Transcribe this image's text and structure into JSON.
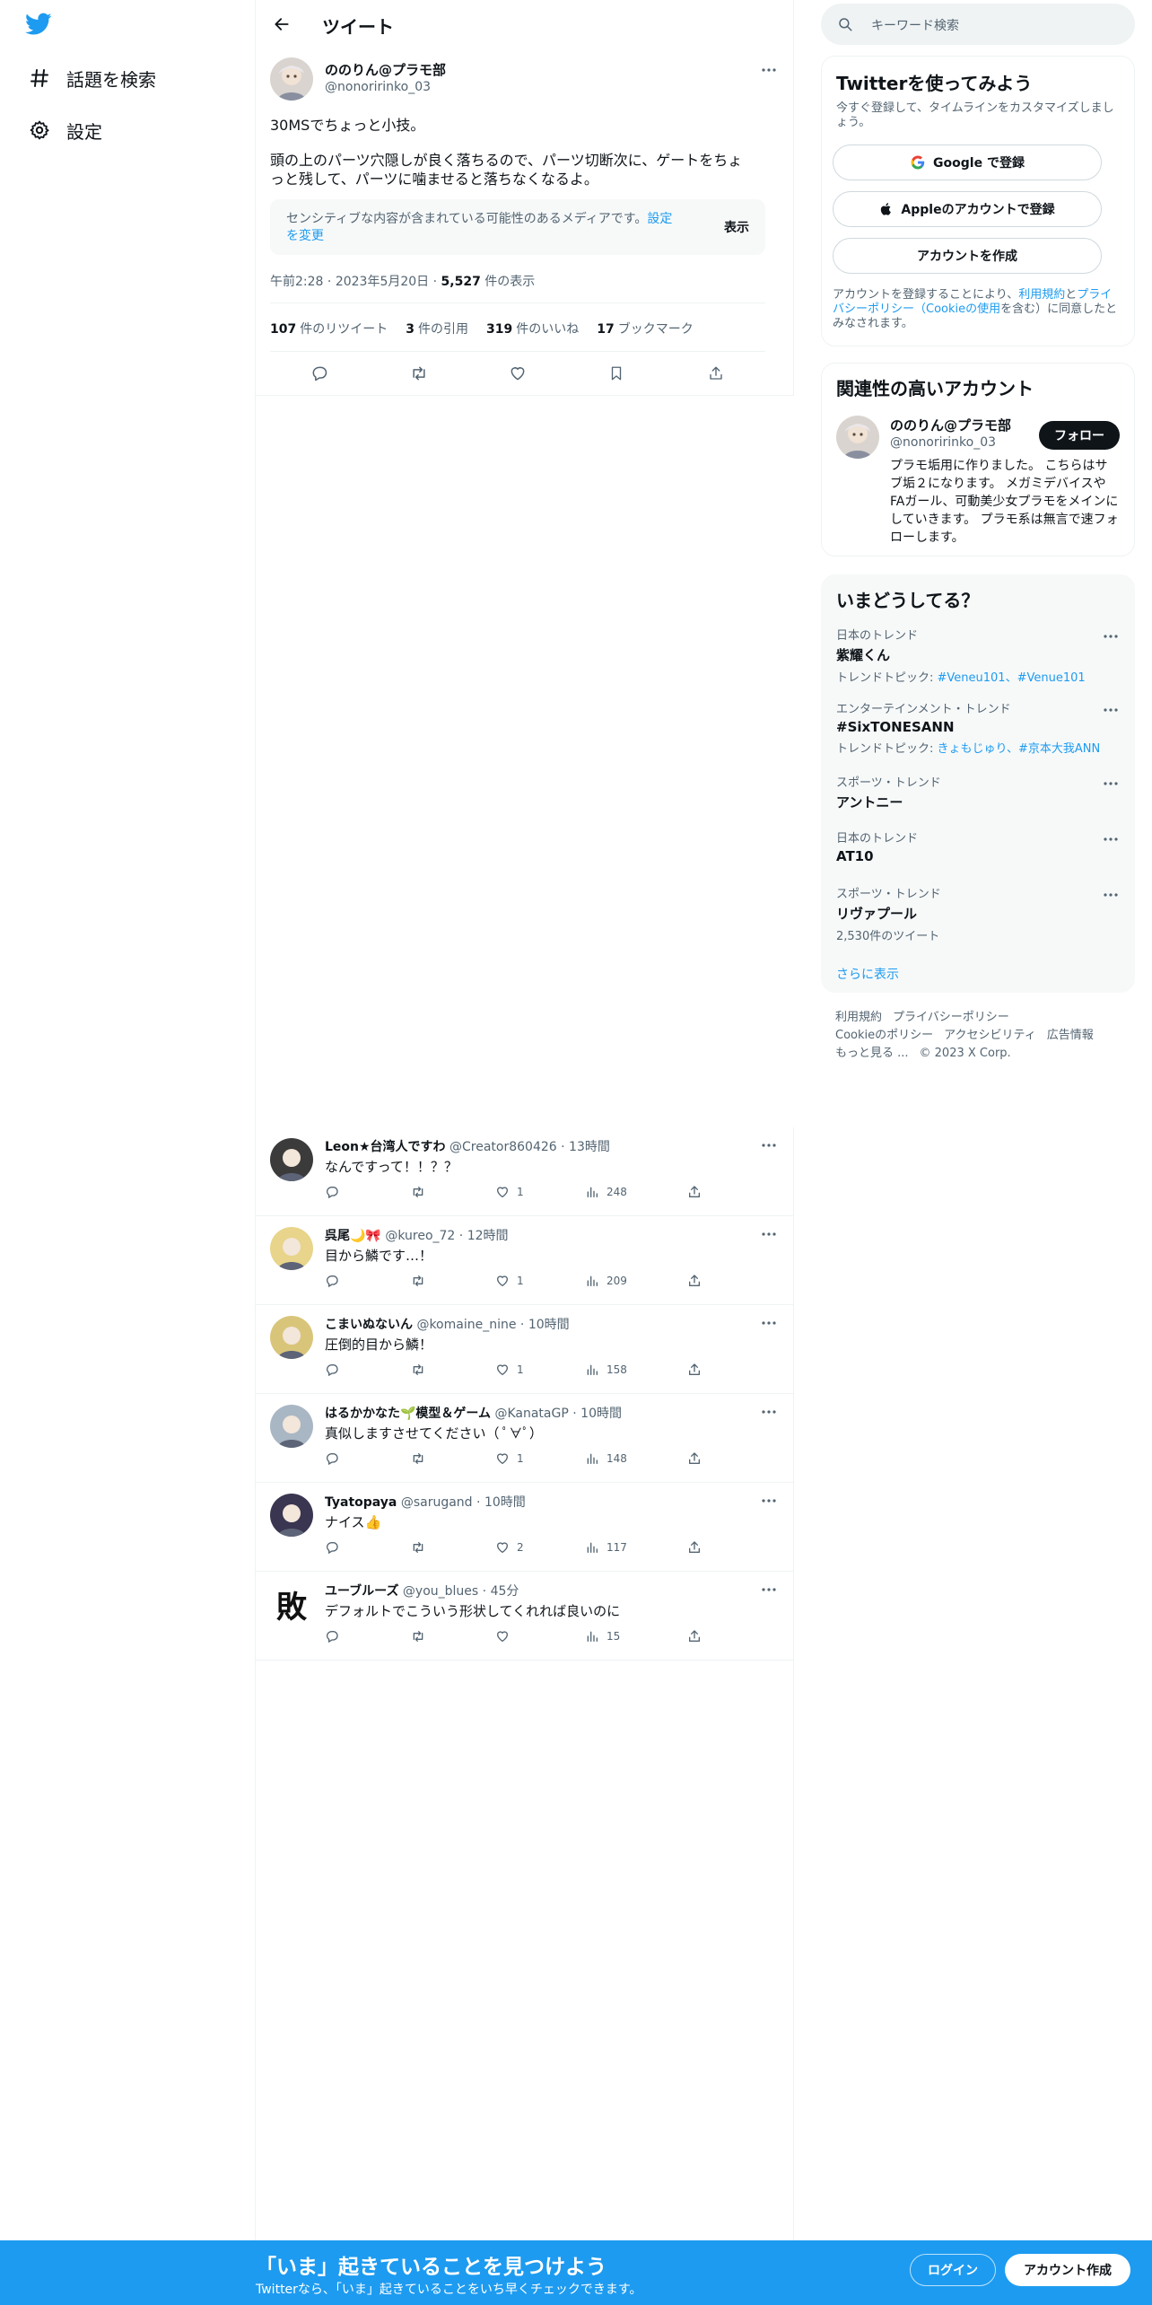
{
  "colors": {
    "accent": "#1d9bf0",
    "text": "#0f1419",
    "muted": "#536471",
    "banner": "#1d9bf0"
  },
  "nav": {
    "logo_icon": "twitter-bird-icon",
    "items": [
      {
        "label": "話題を検索",
        "icon": "hashtag-icon"
      },
      {
        "label": "設定",
        "icon": "gear-icon"
      }
    ]
  },
  "header": {
    "title": "ツイート"
  },
  "tweet": {
    "author_name": "ののりん@プラモ部",
    "author_handle": "@nonoririnko_03",
    "text_line1": "30MSでちょっと小技。",
    "text_line2": "頭の上のパーツ穴隠しが良く落ちるので、パーツ切断次に、ゲートをちょ",
    "text_line3": "っと残して、パーツに噛ませると落ちなくなるよ。",
    "sensitive_notice": "センシティブな内容が含まれている可能性のあるメディアです。",
    "sensitive_link1": "設定",
    "sensitive_link2": "を変更",
    "show_label": "表示",
    "time": "午前2:28",
    "date": "2023年5月20日",
    "views": "5,527",
    "views_label": "件の表示",
    "stats": [
      {
        "count": "107",
        "label": "件のリツイート"
      },
      {
        "count": "3",
        "label": "件の引用"
      },
      {
        "count": "319",
        "label": "件のいいね"
      },
      {
        "count": "17",
        "label": "ブックマーク"
      }
    ]
  },
  "replies": [
    {
      "name": "Leon★台湾人ですわ",
      "handle": "@Creator860426",
      "time": "13時間",
      "text": "なんですって！！？？",
      "likes": "1",
      "views": "248"
    },
    {
      "name": "呉尾🌙🎀",
      "handle": "@kureo_72",
      "time": "12時間",
      "text": "目から鱗です…！",
      "likes": "1",
      "views": "209"
    },
    {
      "name": "こまいぬないん",
      "handle": "@komaine_nine",
      "time": "10時間",
      "text": "圧倒的目から鱗！",
      "likes": "1",
      "views": "158"
    },
    {
      "name": "はるかかなた🌱模型＆ゲーム",
      "handle": "@KanataGP",
      "time": "10時間",
      "text": "真似しますさせてください（ ﾟ∀ﾟ）",
      "likes": "1",
      "views": "148"
    },
    {
      "name": "Tyatopaya",
      "handle": "@sarugand",
      "time": "10時間",
      "text": "ナイス👍",
      "likes": "2",
      "views": "117"
    },
    {
      "name": "ユーブルーズ",
      "handle": "@you_blues",
      "time": "45分",
      "text": "デフォルトでこういう形状してくれれば良いのに",
      "likes": "",
      "views": "15"
    }
  ],
  "right": {
    "search_placeholder": "キーワード検索",
    "signup_panel": {
      "title": "Twitterを使ってみよう",
      "subtitle": "今すぐ登録して、タイムラインをカスタマイズしましょう。",
      "google_btn": "Google で登録",
      "apple_btn": "Appleのアカウントで登録",
      "create_btn": "アカウントを作成",
      "legal_pre": "アカウントを登録することにより、",
      "legal_terms": "利用規約",
      "legal_and": "と",
      "legal_privacy": "プライバシーポリシー（Cookieの使用",
      "legal_post": "を含む）に同意したとみなされます。"
    },
    "related": {
      "title": "関連性の高いアカウント",
      "name": "ののりん@プラモ部",
      "handle": "@nonoririnko_03",
      "follow": "フォロー",
      "bio": "プラモ垢用に作りました。 こちらはサブ垢２になります。 メガミデバイスやFAガール、可動美少女プラモをメインにしていきます。 プラモ系は無言で速フォローします。"
    },
    "trends": {
      "title": "いまどうしてる？",
      "items": [
        {
          "context": "日本のトレンド",
          "name": "紫耀くん",
          "sub_label": "トレンドトピック: ",
          "sub_links": "#Veneu101、#Venue101"
        },
        {
          "context": "エンターテインメント・トレンド",
          "name": "#SixTONESANN",
          "sub_label": "トレンドトピック: ",
          "sub_links": "きょもじゅり、#京本大我ANN"
        },
        {
          "context": "スポーツ・トレンド",
          "name": "アントニー",
          "sub_label": "",
          "sub_links": ""
        },
        {
          "context": "日本のトレンド",
          "name": "AT10",
          "sub_label": "",
          "sub_links": ""
        },
        {
          "context": "スポーツ・トレンド",
          "name": "リヴァプール",
          "sub_label": "2,530件のツイート",
          "sub_links": ""
        }
      ],
      "show_more": "さらに表示"
    },
    "footer": {
      "line1a": "利用規約",
      "line1b": "プライバシーポリシー",
      "line2a": "Cookieのポリシー",
      "line2b": "アクセシビリティ",
      "line2c": "広告情報",
      "line3a": "もっと見る ...",
      "line3b": "© 2023 X Corp."
    }
  },
  "banner": {
    "title": "「いま」起きていることを見つけよう",
    "subtitle": "Twitterなら、「いま」起きていることをいち早くチェックできます。",
    "login": "ログイン",
    "signup": "アカウント作成"
  }
}
